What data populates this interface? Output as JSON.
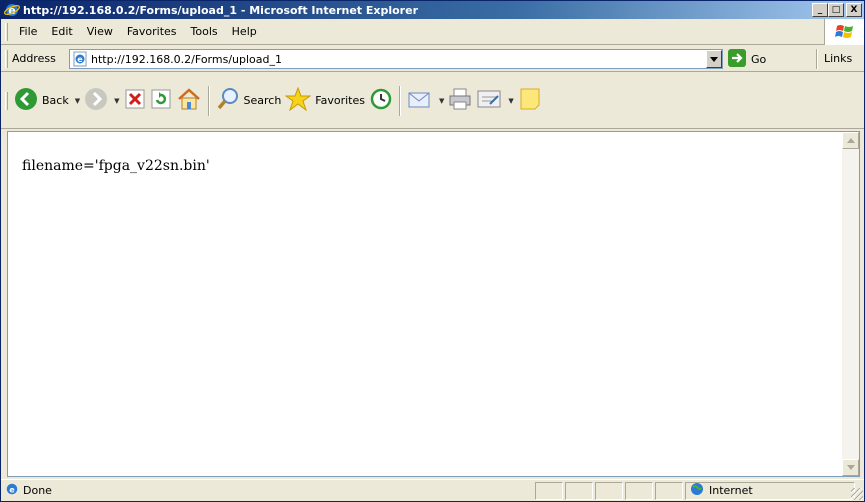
{
  "window": {
    "title": "http://192.168.0.2/Forms/upload_1 - Microsoft Internet Explorer",
    "minimize_label": "_",
    "maximize_label": "□",
    "close_label": "X"
  },
  "menu": {
    "items": [
      {
        "label": "File"
      },
      {
        "label": "Edit"
      },
      {
        "label": "View"
      },
      {
        "label": "Favorites"
      },
      {
        "label": "Tools"
      },
      {
        "label": "Help"
      }
    ]
  },
  "address": {
    "label": "Address",
    "url": "http://192.168.0.2/Forms/upload_1",
    "go_label": "Go",
    "links_label": "Links"
  },
  "toolbar": {
    "back_label": "Back",
    "search_label": "Search",
    "favorites_label": "Favorites"
  },
  "content": {
    "text": "filename='fpga_v22sn.bin'"
  },
  "status": {
    "text": "Done",
    "zone": "Internet"
  },
  "colors": {
    "title_start": "#0a246a",
    "title_end": "#a6caf0",
    "chrome": "#ece9d8"
  }
}
